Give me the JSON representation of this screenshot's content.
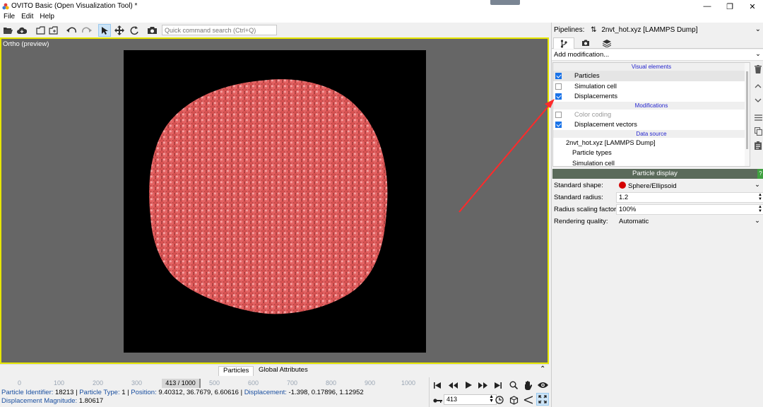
{
  "window": {
    "title": "OVITO Basic (Open Visualization Tool) *"
  },
  "menu": [
    {
      "label": "File"
    },
    {
      "label": "Edit"
    },
    {
      "label": "Help"
    }
  ],
  "toolbar": {
    "search_placeholder": "Quick command search (Ctrl+Q)"
  },
  "viewport": {
    "label": "Ortho (preview)"
  },
  "bottom_tabs": [
    {
      "label": "Particles"
    },
    {
      "label": "Global Attributes"
    }
  ],
  "timeline": {
    "ticks": [
      "0",
      "100",
      "200",
      "300",
      "500",
      "600",
      "700",
      "800",
      "900",
      "1000"
    ],
    "current": "413 / 1000"
  },
  "status": {
    "line1": [
      {
        "k": "Particle Identifier:",
        "v": " 18213 | "
      },
      {
        "k": "Particle Type:",
        "v": " 1 | "
      },
      {
        "k": "Position:",
        "v": " 9.40312, 36.7679, 6.60616 | "
      },
      {
        "k": "Displacement:",
        "v": " -1.398, 0.17896, 1.12952"
      }
    ],
    "line2": {
      "k": "Displacement Magnitude:",
      "v": " 1.80617"
    }
  },
  "animation": {
    "frame": "413"
  },
  "pipeline": {
    "label": "Pipelines:",
    "selected": "2nvt_hot.xyz [LAMMPS Dump]",
    "add_modification": "Add modification...",
    "rows": [
      {
        "kind": "section",
        "label": "Visual elements"
      },
      {
        "kind": "item",
        "label": "Particles",
        "checked": true,
        "selected": true
      },
      {
        "kind": "item",
        "label": "Simulation cell",
        "checked": false
      },
      {
        "kind": "item",
        "label": "Displacements",
        "checked": true
      },
      {
        "kind": "section",
        "label": "Modifications"
      },
      {
        "kind": "item",
        "label": "Color coding",
        "checked": false,
        "dim": true
      },
      {
        "kind": "item",
        "label": "Displacement vectors",
        "checked": true
      },
      {
        "kind": "section",
        "label": "Data source"
      },
      {
        "kind": "plain",
        "label": "2nvt_hot.xyz [LAMMPS Dump]",
        "indent": 1
      },
      {
        "kind": "plain",
        "label": "Particle types",
        "indent": 2
      },
      {
        "kind": "plain",
        "label": "Simulation cell",
        "indent": 2
      }
    ]
  },
  "particle_display": {
    "title": "Particle display",
    "help": "?",
    "properties": [
      {
        "label": "Standard shape:",
        "value": "Sphere/Ellipsoid"
      },
      {
        "label": "Standard radius:",
        "value": "1.2"
      },
      {
        "label": "Radius scaling factor:",
        "value": "100%"
      },
      {
        "label": "Rendering quality:",
        "value": "Automatic"
      }
    ]
  },
  "colors": {
    "viewport_border": "#e6e600",
    "particle": "#e05a5a",
    "annotation_arrow": "#ff2a2a",
    "section_text": "#2525ce"
  }
}
